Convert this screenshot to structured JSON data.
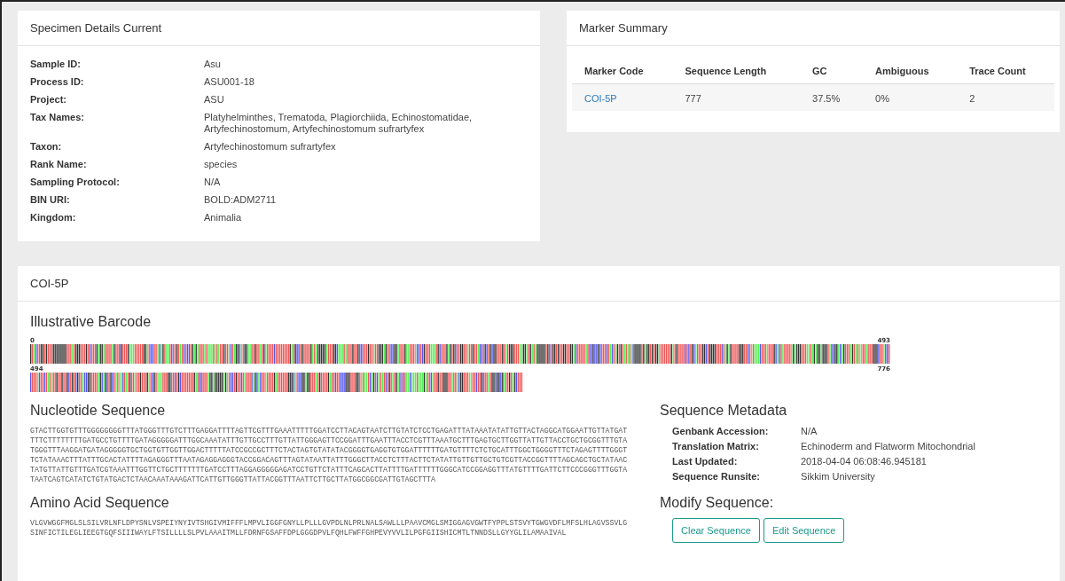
{
  "specimen": {
    "title": "Specimen Details Current",
    "fields": [
      {
        "label": "Sample ID:",
        "value": "Asu"
      },
      {
        "label": "Process ID:",
        "value": "ASU001-18"
      },
      {
        "label": "Project:",
        "value": "ASU"
      },
      {
        "label": "Tax Names:",
        "value": "Platyhelminthes, Trematoda, Plagiorchiida, Echinostomatidae, Artyfechinostomum, Artyfechinostomum sufrartyfex"
      },
      {
        "label": "Taxon:",
        "value": "Artyfechinostomum sufrartyfex"
      },
      {
        "label": "Rank Name:",
        "value": "species"
      },
      {
        "label": "Sampling Protocol:",
        "value": "N/A"
      },
      {
        "label": "BIN URI:",
        "value": "BOLD:ADM2711"
      },
      {
        "label": "Kingdom:",
        "value": "Animalia"
      }
    ]
  },
  "marker_summary": {
    "title": "Marker Summary",
    "columns": [
      "Marker Code",
      "Sequence Length",
      "GC",
      "Ambiguous",
      "Trace Count"
    ],
    "rows": [
      [
        "COI-5P",
        "777",
        "37.5%",
        "0%",
        "2"
      ]
    ]
  },
  "marker": {
    "title": "COI-5P",
    "barcode": {
      "title": "Illustrative Barcode",
      "rows": [
        {
          "start": "0",
          "end": "493"
        },
        {
          "start": "494",
          "end": "776"
        }
      ]
    },
    "nucleotide": {
      "title": "Nucleotide Sequence",
      "lines": [
        "GTACTTGGTGTTTGGGGGGGGTTTATGGGTTTGTCTTTGAGGATTTTAGTTCGTTTGAAATTTTTGGATCCTTACAGTAATCTTGTATCTCCTGAGATTTATAAATATATTGTTACTAGGCATGGAATTGTTATGAT",
        "TTTCTTTTTTTTGATGCCTGTTTTGATAGGGGGATTTGGCAAATATTTGTTGCCTTTGTTATTGGGAGTTCCGGATTTGAATTTACCTCGTTTAAATGCTTTGAGTGCTTGGTTATTGTTACCTGCTGCGGTTTGTA",
        "TGGGTTTAAGGATGATAGGGGGTGCTGGTGTTGGTTGGACTTTTTATCCGCCGCTTTCTACTAGTGTATATACGGGGTGAGGTGTGGATTTTTTGATGTTTTCTCTGCATTTGGCTGGGGTTTCTAGAGTTTTGGGT",
        "TCTATAAACTTTATTTGCACTATTTTAGAGGGTTTAATAGAGGAGGGTACCGGACAGTTTAGTATAATTATTTGGGCTTACCTCTTTACTTCTATATTGTTGTTGCTGTCGTTACCGGTTTTAGCAGCTGCTATAAC",
        "TATGTTATTGTTTGATCGTAAATTTGGTTCTGCTTTTTTTGATCCTTTAGGAGGGGGAGATCCTGTTCTATTTCAGCACTTATTTTGATTTTTTGGGCATCCGGAGGTTTATGTTTTGATTCTTCCCGGGTTTGGTA",
        "TAATCAGTCATATCTGTATGACTCTAACAAATAAAGATTCATTGTTGGGTTATTACGGTTTAATTCTTGCTTATGGCGGCGATTGTAGCTTTA"
      ]
    },
    "amino": {
      "title": "Amino Acid Sequence",
      "lines": [
        "VLGVWGGFMGLSLSILVRLNFLDPYSNLVSPEIYNYIVTSHGIVMIFFFLMPVLIGGFGNYLLPLLLGVPDLNLPRLNALSAWLLLPAAVCMGLSMIGGAGVGWTFYPPLSTSVYTGWGVDFLMFSLHLAGVSSVLG",
        "SINFICTILEGLIEEGTGQFSIIIWAYLFTSILLLLSLPVLAAAITMLLFDRNFGSAFFDPLGGGDPVLFQHLFWFFGHPEVYVVLILPGFGIISHICMTLTNNDSLLGYYGLILAMAAIVAL"
      ]
    },
    "metadata": {
      "title": "Sequence Metadata",
      "fields": [
        {
          "label": "Genbank Accession:",
          "value": "N/A"
        },
        {
          "label": "Translation Matrix:",
          "value": "Echinoderm and Flatworm Mitochondrial"
        },
        {
          "label": "Last Updated:",
          "value": "2018-04-04 06:08:46.945181"
        },
        {
          "label": "Sequence Runsite:",
          "value": "Sikkim University"
        }
      ]
    },
    "modify": {
      "title": "Modify Sequence:",
      "buttons": [
        "Clear Sequence",
        "Edit Sequence"
      ]
    }
  }
}
